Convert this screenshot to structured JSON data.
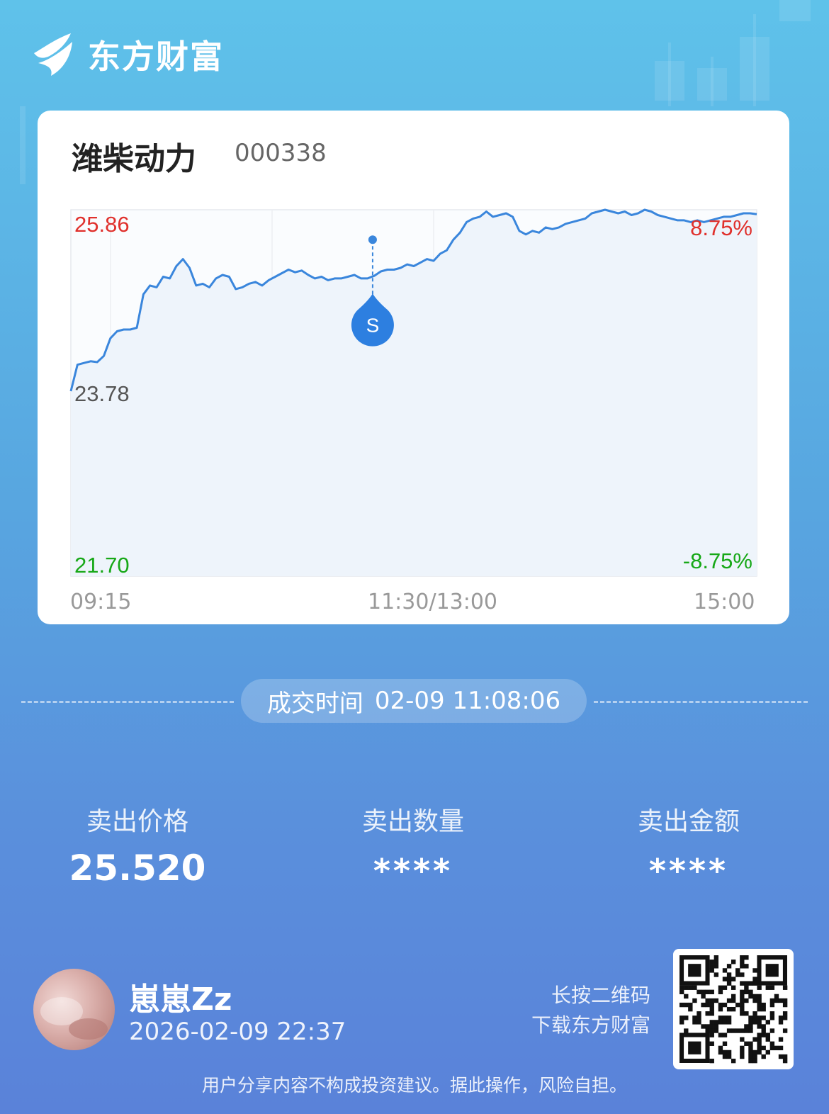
{
  "brand": {
    "name": "东方财富",
    "logo_icon": "eastmoney-logo-icon"
  },
  "stock": {
    "name": "潍柴动力",
    "code": "000338"
  },
  "chart_data": {
    "type": "line",
    "y_labels": {
      "high": "25.86",
      "mid": "23.78",
      "low": "21.70",
      "high_pct": "8.75%",
      "low_pct": "-8.75%"
    },
    "ylim": [
      21.7,
      25.86
    ],
    "x_ticks": [
      "09:15",
      "11:30/13:00",
      "15:00"
    ],
    "grid": true,
    "marker": {
      "label": "S",
      "time_index": 0.44,
      "price": 25.52
    },
    "colors": {
      "line": "#3a86dc",
      "fill": "#eef4fb",
      "up": "#e0302c",
      "down": "#17a817",
      "neutral": "#555555"
    },
    "series": [
      {
        "values": [
          23.8,
          24.1,
          24.12,
          24.14,
          24.13,
          24.2,
          24.4,
          24.48,
          24.5,
          24.5,
          24.52,
          24.9,
          25.0,
          24.98,
          25.1,
          25.08,
          25.22,
          25.3,
          25.2,
          25.0,
          25.02,
          24.98,
          25.08,
          25.12,
          25.1,
          24.96,
          24.98,
          25.02,
          25.04,
          25.0,
          25.06,
          25.1,
          25.14,
          25.18,
          25.15,
          25.17,
          25.12,
          25.08,
          25.1,
          25.06,
          25.08,
          25.08,
          25.1,
          25.12,
          25.08,
          25.08,
          25.11,
          25.16,
          25.18,
          25.18,
          25.2,
          25.24,
          25.22,
          25.26,
          25.3,
          25.28,
          25.36,
          25.4,
          25.52,
          25.6,
          25.72,
          25.76,
          25.78,
          25.84,
          25.78,
          25.8,
          25.82,
          25.78,
          25.62,
          25.58,
          25.62,
          25.6,
          25.66,
          25.64,
          25.66,
          25.7,
          25.72,
          25.74,
          25.76,
          25.82,
          25.84,
          25.86,
          25.84,
          25.82,
          25.84,
          25.8,
          25.82,
          25.86,
          25.84,
          25.8,
          25.78,
          25.76,
          25.74,
          25.74,
          25.72,
          25.74,
          25.72,
          25.74,
          25.76,
          25.78,
          25.78,
          25.8,
          25.82,
          25.82,
          25.81
        ]
      }
    ]
  },
  "trade": {
    "time_label": "成交时间",
    "time_value": "02-09 11:08:06"
  },
  "stats": [
    {
      "label": "卖出价格",
      "value": "25.520"
    },
    {
      "label": "卖出数量",
      "value": "****"
    },
    {
      "label": "卖出金额",
      "value": "****"
    }
  ],
  "user": {
    "name": "崽崽Zz",
    "share_time": "2026-02-09 22:37"
  },
  "qr": {
    "hint_line1": "长按二维码",
    "hint_line2": "下载东方财富"
  },
  "disclaimer": "用户分享内容不构成投资建议。据此操作，风险自担。"
}
